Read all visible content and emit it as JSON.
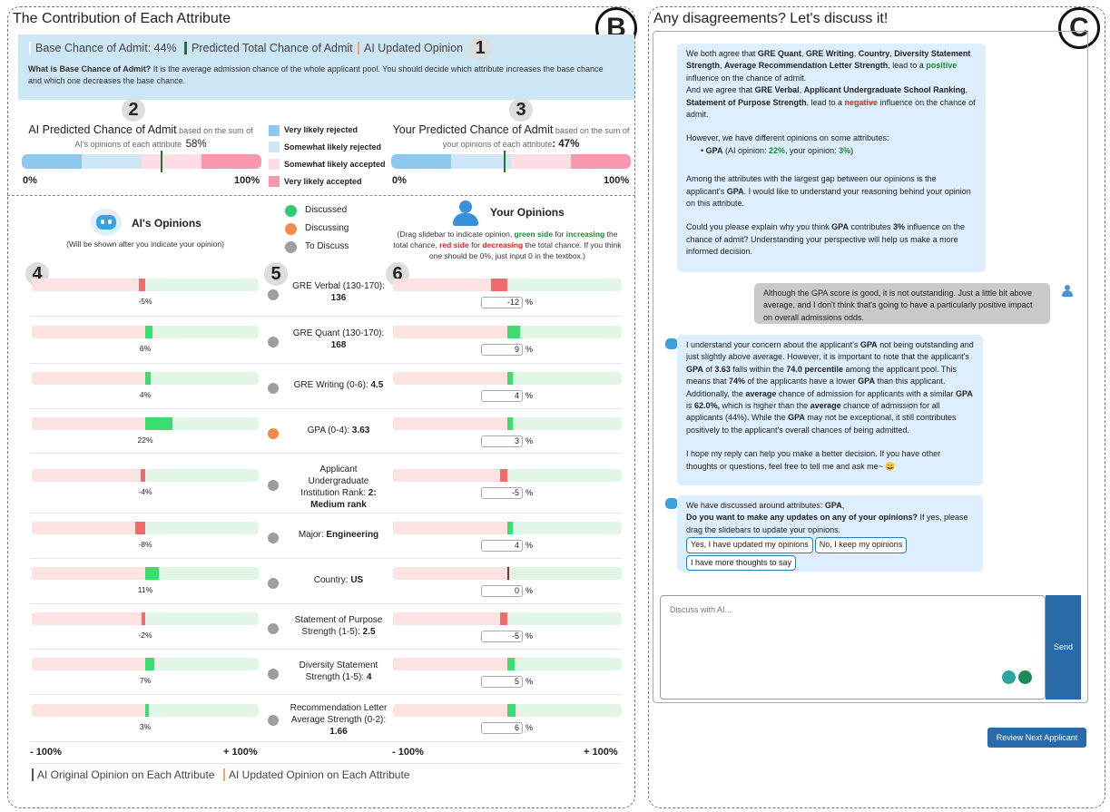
{
  "left_panel": {
    "title": "The Contribution of Each Attribute",
    "badge": "B"
  },
  "right_panel": {
    "title": "Any disagreements? Let's discuss it!",
    "badge": "C"
  },
  "numbers": [
    "1",
    "2",
    "3",
    "4",
    "5",
    "6"
  ],
  "legend": {
    "base": "Base Chance of Admit: 44%",
    "predicted": "Predicted Total Chance of Admit",
    "updated": "AI Updated Opinion"
  },
  "base_info": {
    "question": "What is Base Chance of Admit?",
    "text": " It is the average admission chance of the whole applicant pool. You should decide which attribute increases the base chance and which one decreases the base chance."
  },
  "ai_pred": {
    "label": "AI Predicted Chance of Admit",
    "sub": " based on the sum of AI's opinions of each attribute",
    "value": "58%",
    "level": 0.58
  },
  "your_pred": {
    "label": "Your Predicted Chance of Admit",
    "sub": " based on the sum of your opinions of each attribute",
    "value": ": 47%",
    "level": 0.47
  },
  "bar_ends": {
    "left": "0%",
    "right": "100%"
  },
  "bar_legend": [
    "Very likely rejected",
    "Somewhat likely rejected",
    "Somewhat likely accepted",
    "Very likely accepted"
  ],
  "colors": {
    "very_rej": "#8cc8f0",
    "some_rej": "#cfe6f7",
    "some_acc": "#fcdde3",
    "very_acc": "#f898ae",
    "neg": "#f26b6b",
    "pos": "#3ddc6e",
    "mark": "#1a7a2a",
    "orange": "#f5894a",
    "gray": "#9e9e9e",
    "green": "#2ecc71"
  },
  "ai_head": {
    "title": "AI's Opinions",
    "note": "(Will be shown after you indicate your opinion)"
  },
  "status": [
    "Discussed",
    "Discussing",
    "To Discuss"
  ],
  "you_head": {
    "title": "Your Opinions",
    "n1": "(Drag slidebar to indicate opinion, ",
    "g": "green side",
    "n2": " for ",
    "inc": "increasing",
    "n3": " the total chance, ",
    "r": "red side",
    "n4": " for ",
    "dec": "decreasing",
    "n5": " the total chance. If you think one should be 0%, just input 0 in the textbox.)"
  },
  "attributes": [
    {
      "l1": "GRE Verbal (130-170):",
      "l2": "",
      "v": "136",
      "ai": "-5%",
      "aiv": -5,
      "you": "-12",
      "yv": -12,
      "st": "gray"
    },
    {
      "l1": "GRE Quant (130-170):",
      "l2": "",
      "v": "168",
      "ai": "6%",
      "aiv": 6,
      "you": "9",
      "yv": 9,
      "st": "gray"
    },
    {
      "l1": "GRE Writing (0-6): ",
      "l2": "",
      "v": "4.5",
      "ai": "4%",
      "aiv": 4,
      "you": "4",
      "yv": 4,
      "st": "gray"
    },
    {
      "l1": "GPA (0-4): ",
      "l2": "",
      "v": "3.63",
      "ai": "22%",
      "aiv": 22,
      "you": "3",
      "yv": 3,
      "st": "orange"
    },
    {
      "l1": "Applicant",
      "l2": "Undergraduate",
      "l3": "Institution Rank: ",
      "v": "2:",
      "v2": "Medium rank",
      "ai": "-4%",
      "aiv": -4,
      "you": "-5",
      "yv": -5,
      "st": "gray"
    },
    {
      "l1": "Major: ",
      "l2": "",
      "v": "Engineering",
      "ai": "-8%",
      "aiv": -8,
      "you": "4",
      "yv": 4,
      "st": "gray"
    },
    {
      "l1": "Country: ",
      "l2": "",
      "v": "US",
      "ai": "11%",
      "aiv": 11,
      "you": "0",
      "yv": 0,
      "st": "gray"
    },
    {
      "l1": "Statement of Purpose",
      "l2": "Strength (1-5): ",
      "v": "2.5",
      "ai": "-2%",
      "aiv": -2,
      "you": "-5",
      "yv": -5,
      "st": "gray"
    },
    {
      "l1": "Diversity Statement",
      "l2": "Strength (1-5): ",
      "v": "4",
      "ai": "7%",
      "aiv": 7,
      "you": "5",
      "yv": 5,
      "st": "gray"
    },
    {
      "l1": "Recommendation Letter",
      "l2": "Average Strength (0-2):",
      "v": "1.66",
      "ai": "3%",
      "aiv": 3,
      "you": "6",
      "yv": 6,
      "st": "gray"
    }
  ],
  "pct": "%",
  "axis": {
    "l": "- 100%",
    "r": "+ 100%"
  },
  "bottom_legend": {
    "orig": "AI Original Opinion on Each Attribute",
    "upd": "AI Updated Opinion on Each Attribute"
  },
  "chat": {
    "m1": {
      "a": "We both agree that ",
      "b1": "GRE Quant",
      "c1": ", ",
      "b2": "GRE Writing",
      "c2": ", ",
      "b3": "Country",
      "c3": ", ",
      "b4": "Diversity Statement Strength",
      "c4": ", ",
      "b5": "Average Recommendation Letter Strength",
      "c5": ", lead to a ",
      "pos": "positive",
      "c6": " influence on the chance of admit.",
      "d": "And we agree that ",
      "e1": "GRE Verbal",
      "e2": ", ",
      "e3": "Applicant Undergraduate School Ranking",
      "e4": ", ",
      "e5": "Statement of Purpose Strength",
      "e6": ", lead to a ",
      "neg": "negative",
      "e7": " influence on the chance of admit.",
      "f": "However, we have different opinions on some attributes:",
      "g1": "GPA",
      "g2": " (AI opinion: ",
      "g3": "22%",
      "g4": ", your opinion: ",
      "g5": "3%",
      "g6": ")",
      "h1": "Among the attributes with the largest gap between our opinions is the applicant's ",
      "h2": "GPA",
      "h3": ". I would like to understand your reasoning behind your opinion on this attribute.",
      "i1": "Could you please explain why you think ",
      "i2": "GPA",
      "i3": " contributes ",
      "i4": "3%",
      "i5": " influence on the chance of admit? Understanding your perspective will help us make a more informed decision."
    },
    "user": "Although the GPA score is good, it is not outstanding. Just a little bit above average, and I don't think that's going to have a particularly positive impact on overall admissions odds.",
    "m2": {
      "a": "I understand your concern about the applicant's ",
      "b": "GPA",
      "c": " not being outstanding and just slightly above average. However, it is important to note that the applicant's ",
      "d": "GPA",
      "e": " of ",
      "f": "3.63",
      "g": " falls within the ",
      "h": "74.0 percentile",
      "i": " among the applicant pool. This means that ",
      "j": "74%",
      "k": " of the applicants have a lower ",
      "l": "GPA",
      "m": " than this applicant. Additionally, the ",
      "n": "average",
      "o": " chance of admission for applicants with a similar ",
      "p": "GPA",
      "q": " is ",
      "r": "62.0%,",
      "s": " which is higher than the ",
      "t": "average",
      "u": " chance of admission for all applicants (44%). While the ",
      "v": "GPA",
      "w": " may not be exceptional, it still contributes positively to the applicant's overall chances of being admitted.",
      "x": "I hope my reply can help you make a better decision. If you have other thoughts or questions, feel free to tell me and ask me~ ",
      "emoji": "😀"
    },
    "m3": {
      "a": "We have discussed around attributes: ",
      "b": "GPA",
      "c": ",",
      "d": "Do you want to make any updates on any of your opinions?",
      "e": " If yes, please drag the slidebars to update your opinions."
    },
    "buttons": [
      "Yes, I have updated my opinions",
      "No, I keep my opinions",
      "I have more thoughts to say"
    ],
    "placeholder": "Discuss with AI...",
    "send": "Send",
    "review": "Review Next Applicant"
  }
}
